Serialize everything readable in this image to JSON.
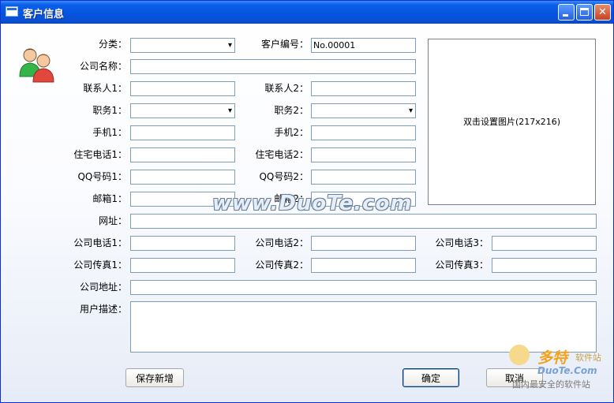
{
  "window": {
    "title": "客户信息"
  },
  "form": {
    "category_label": "分类：",
    "category_value": "",
    "customer_no_label": "客户编号：",
    "customer_no_value": "No.00001",
    "company_name_label": "公司名称：",
    "company_name_value": "",
    "contact1_label": "联系人1：",
    "contact1_value": "",
    "contact2_label": "联系人2：",
    "contact2_value": "",
    "title1_label": "职务1：",
    "title1_value": "",
    "title2_label": "职务2：",
    "title2_value": "",
    "mobile1_label": "手机1：",
    "mobile1_value": "",
    "mobile2_label": "手机2：",
    "mobile2_value": "",
    "home_phone1_label": "住宅电话1：",
    "home_phone1_value": "",
    "home_phone2_label": "住宅电话2：",
    "home_phone2_value": "",
    "qq1_label": "QQ号码1：",
    "qq1_value": "",
    "qq2_label": "QQ号码2：",
    "qq2_value": "",
    "email1_label": "邮箱1：",
    "email1_value": "",
    "email2_label": "邮箱2：",
    "email2_value": "",
    "website_label": "网址：",
    "website_value": "",
    "company_phone1_label": "公司电话1：",
    "company_phone1_value": "",
    "company_phone2_label": "公司电话2：",
    "company_phone2_value": "",
    "company_phone3_label": "公司电话3：",
    "company_phone3_value": "",
    "company_fax1_label": "公司传真1：",
    "company_fax1_value": "",
    "company_fax2_label": "公司传真2：",
    "company_fax2_value": "",
    "company_fax3_label": "公司传真3：",
    "company_fax3_value": "",
    "company_address_label": "公司地址：",
    "company_address_value": "",
    "description_label": "用户描述：",
    "description_value": ""
  },
  "photo": {
    "hint": "双击设置图片(217x216)"
  },
  "buttons": {
    "save_new": "保存新增",
    "ok": "确定",
    "cancel": "取消"
  },
  "watermark": {
    "text": "www.DuoTe.com"
  },
  "logo": {
    "line1": "多特",
    "line1b": "软件站",
    "line2": "DuoTe.Com",
    "line3": "国内最安全的软件站"
  },
  "icons": {
    "window": "window-icon",
    "users": "users-icon",
    "minimize": "minimize-icon",
    "maximize": "maximize-icon",
    "close": "close-icon"
  },
  "colors": {
    "titlebar": "#0555e1",
    "close_button": "#c64223",
    "input_border": "#7f9db9"
  }
}
